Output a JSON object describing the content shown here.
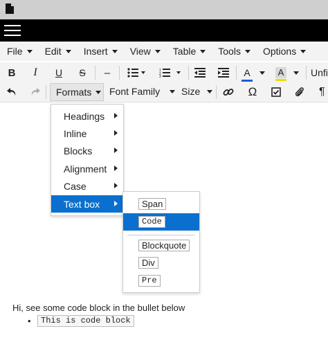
{
  "menubar": {
    "items": [
      "File",
      "Edit",
      "Insert",
      "View",
      "Table",
      "Tools",
      "Options"
    ]
  },
  "toolbar": {
    "bold_label": "B",
    "italic_label": "I",
    "underline_label": "U",
    "strike_label": "S",
    "hr_label": "–",
    "font_color_label": "A",
    "highlight_label": "A",
    "unfill_label": "Unfil",
    "formats_label": "Formats",
    "font_family_label": "Font Family",
    "size_label": "Size",
    "omega_label": "Ω",
    "para_label": "¶",
    "font_color": "#1a5ed1",
    "highlight_color": "#e8e000",
    "accent": "#0a6fcf"
  },
  "formats_menu": {
    "items": [
      "Headings",
      "Inline",
      "Blocks",
      "Alignment",
      "Case",
      "Text box"
    ],
    "active": "Text box"
  },
  "textbox_menu": {
    "items": [
      "Span",
      "Code",
      "Blockquote",
      "Div",
      "Pre"
    ],
    "active": "Code"
  },
  "content": {
    "paragraph": "Hi, see some code block in the bullet below",
    "bullet_code": "This is code block"
  }
}
